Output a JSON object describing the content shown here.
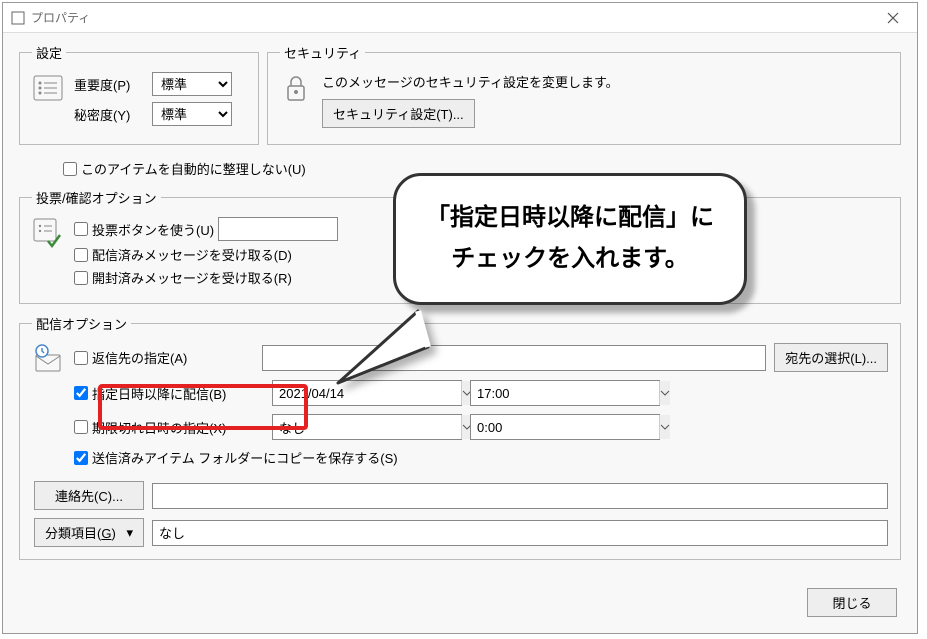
{
  "window": {
    "title": "プロパティ"
  },
  "settings": {
    "legend": "設定",
    "importance_label": "重要度(P)",
    "importance_value": "標準",
    "confidentiality_label": "秘密度(Y)",
    "confidentiality_value": "標準",
    "auto_organize_label": "このアイテムを自動的に整理しない(U)"
  },
  "security": {
    "legend": "セキュリティ",
    "description": "このメッセージのセキュリティ設定を変更します。",
    "button": "セキュリティ設定(T)..."
  },
  "voting": {
    "legend": "投票/確認オプション",
    "use_voting_label": "投票ボタンを使う(U)",
    "delivery_receipt_label": "配信済みメッセージを受け取る(D)",
    "read_receipt_label": "開封済みメッセージを受け取る(R)"
  },
  "delivery": {
    "legend": "配信オプション",
    "reply_to_label": "返信先の指定(A)",
    "select_names_button": "宛先の選択(L)...",
    "delay_delivery_label": "指定日時以降に配信(B)",
    "delay_date": "2021/04/14",
    "delay_time": "17:00",
    "expire_label": "期限切れ日時の指定(X)",
    "expire_date": "なし",
    "expire_time": "0:00",
    "save_sent_label": "送信済みアイテム フォルダーにコピーを保存する(S)",
    "contacts_button": "連絡先(C)...",
    "categories_button_pre": "分類項目(",
    "categories_key": "G",
    "categories_button_post": ")",
    "categories_value": "なし"
  },
  "callout": {
    "line1": "「指定日時以降に配信」に",
    "line2": "チェックを入れます。"
  },
  "footer": {
    "close_button": "閉じる"
  }
}
